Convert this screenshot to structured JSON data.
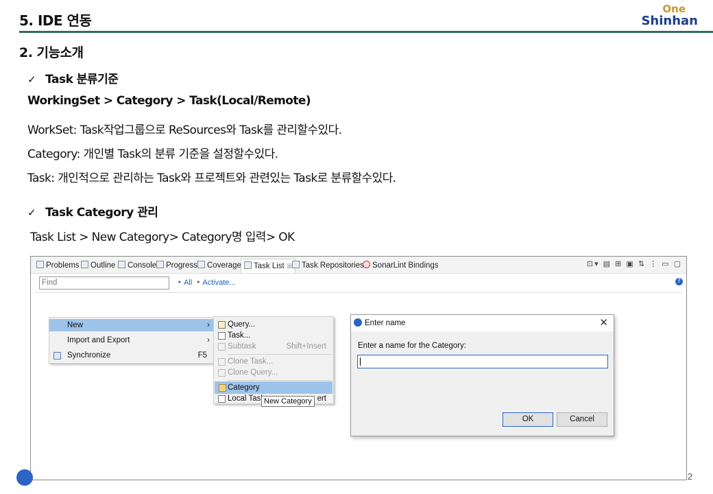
{
  "slide": {
    "title": "5. IDE 연동",
    "logo": {
      "top": "One",
      "bottom": "Shinhan"
    },
    "section_title": "2. 기능소개",
    "check_mark": "✓",
    "bullet1": "Task 분류기준",
    "hierarchy": "WorkingSet > Category > Task(Local/Remote)",
    "line_workset": "WorkSet: Task작업그룹으로 ReSources와 Task를 관리할수있다.",
    "line_category": "Category: 개인별 Task의 분류 기준을 설정할수있다.",
    "line_task": "Task: 개인적으로 관리하는 Task와 프로젝트와 관련있는 Task로 분류할수있다.",
    "bullet2": "Task Category 관리",
    "steps": "Task List > New Category> Category명 입력> OK",
    "page_number": "2"
  },
  "ide": {
    "tabs": [
      {
        "label": "Problems",
        "icon": "problems-icon"
      },
      {
        "label": "Outline",
        "icon": "outline-icon"
      },
      {
        "label": "Console",
        "icon": "console-icon"
      },
      {
        "label": "Progress",
        "icon": "progress-icon"
      },
      {
        "label": "Coverage",
        "icon": "coverage-icon"
      },
      {
        "label": "Task List",
        "icon": "task-list-icon",
        "active": true
      },
      {
        "label": "Task Repositories",
        "icon": "task-repositories-icon"
      },
      {
        "label": "SonarLint Bindings",
        "icon": "sonarlint-icon"
      }
    ],
    "tab_close_glyph": "☒",
    "toolbar_glyphs": "⊡▾ ▤ ⊞ ▣ ⇅ ⋮ ▭ ▢",
    "find_placeholder": "Find",
    "filter_all": "All",
    "filter_activate": "Activate...",
    "help_glyph": "?",
    "context_menu": {
      "items": [
        {
          "label": "New",
          "arrow": "›",
          "selected": true
        },
        {
          "label": "Import and Export",
          "arrow": "›"
        },
        {
          "label": "Synchronize",
          "shortcut": "F5",
          "icon": "synchronize-icon"
        }
      ]
    },
    "submenu": {
      "items": [
        {
          "label": "Query...",
          "icon": "query-icon"
        },
        {
          "label": "Task...",
          "icon": "task-icon"
        },
        {
          "label": "Subtask",
          "shortcut": "Shift+Insert",
          "icon": "subtask-icon",
          "disabled": true
        },
        {
          "label": "Clone Task...",
          "icon": "clone-task-icon",
          "disabled": true
        },
        {
          "label": "Clone Query...",
          "icon": "clone-query-icon",
          "disabled": true
        },
        {
          "label": "Category",
          "icon": "category-icon",
          "selected": true
        },
        {
          "label": "Local Task",
          "shortcut": "ert",
          "icon": "local-task-icon"
        }
      ]
    },
    "tooltip": "New Category",
    "dialog": {
      "title": "Enter name",
      "close_glyph": "✕",
      "message": "Enter a name for the Category:",
      "input_value": "",
      "ok_label": "OK",
      "cancel_label": "Cancel"
    }
  }
}
